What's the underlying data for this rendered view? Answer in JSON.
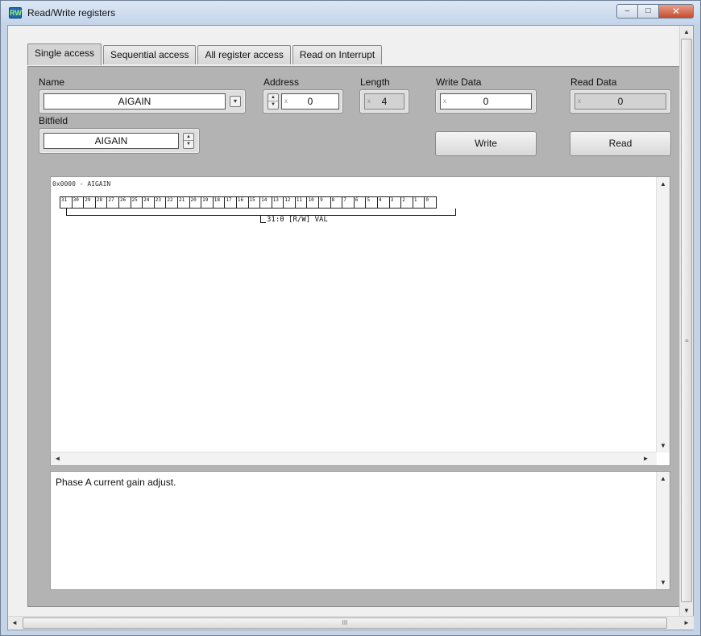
{
  "window": {
    "title": "Read/Write registers",
    "icon_text": "RW",
    "minimize": "–",
    "maximize": "□",
    "close": "✕"
  },
  "tabs": [
    {
      "label": "Single access"
    },
    {
      "label": "Sequential access"
    },
    {
      "label": "All register access"
    },
    {
      "label": "Read on Interrupt"
    }
  ],
  "form": {
    "name_label": "Name",
    "name_value": "AIGAIN",
    "address_label": "Address",
    "address_value": "0",
    "length_label": "Length",
    "length_value": "4",
    "write_data_label": "Write Data",
    "write_data_value": "0",
    "read_data_label": "Read Data",
    "read_data_value": "0",
    "bitfield_label": "Bitfield",
    "bitfield_value": "AIGAIN",
    "write_button": "Write",
    "read_button": "Read",
    "radix_marker": "x"
  },
  "diagram": {
    "title": "0x0000 - AIGAIN",
    "bits": [
      "31",
      "30",
      "29",
      "28",
      "27",
      "26",
      "25",
      "24",
      "23",
      "22",
      "21",
      "20",
      "19",
      "18",
      "17",
      "16",
      "15",
      "14",
      "13",
      "12",
      "11",
      "10",
      "9",
      "8",
      "7",
      "6",
      "5",
      "4",
      "3",
      "2",
      "1",
      "0"
    ],
    "field_label": "31:0 [R/W] VAL"
  },
  "description": {
    "text": "Phase A current gain adjust."
  },
  "scroll": {
    "up": "▲",
    "down": "▼",
    "left": "◄",
    "right": "►",
    "grip_v": "≡",
    "grip_h": "III"
  },
  "colors": {
    "panel_bg": "#b3b3b3",
    "title_bar": "#c3d4ea",
    "close_button": "#c64b2e"
  }
}
